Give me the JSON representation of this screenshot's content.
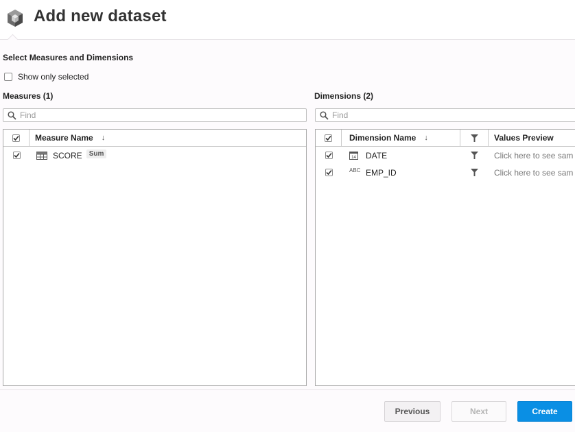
{
  "header": {
    "title": "Add new dataset"
  },
  "section": {
    "title": "Select Measures and Dimensions"
  },
  "show_only_selected": {
    "label": "Show only selected",
    "checked": false
  },
  "measures": {
    "title": "Measures (1)",
    "find_placeholder": "Find",
    "columns": {
      "name": "Measure Name"
    },
    "rows": [
      {
        "name": "SCORE",
        "aggregation": "Sum",
        "icon": "measure-icon",
        "checked": true
      }
    ]
  },
  "dimensions": {
    "title": "Dimensions (2)",
    "find_placeholder": "Find",
    "columns": {
      "name": "Dimension Name",
      "values": "Values Preview"
    },
    "rows": [
      {
        "name": "DATE",
        "icon": "calendar-icon",
        "icon_text": "14",
        "preview": "Click here to see sam",
        "checked": true
      },
      {
        "name": "EMP_ID",
        "icon": "text-type-icon",
        "icon_text": "ABC",
        "preview": "Click here to see sam",
        "checked": true
      }
    ]
  },
  "footer": {
    "previous": "Previous",
    "next": "Next",
    "create": "Create"
  },
  "colors": {
    "accent": "#0a8fe4"
  }
}
